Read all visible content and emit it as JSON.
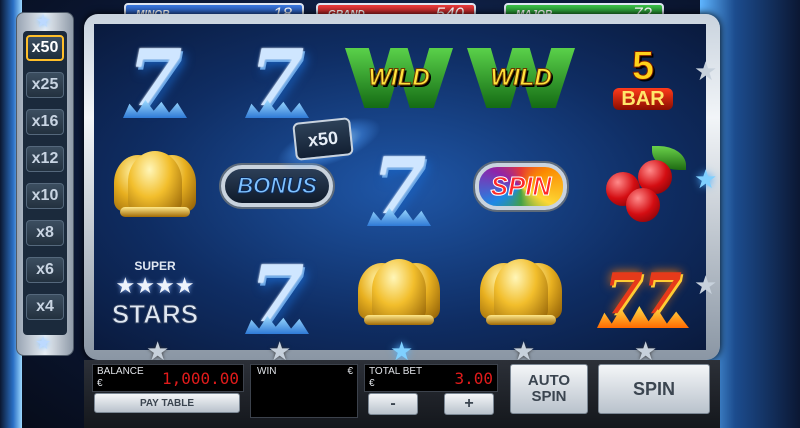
{
  "jackpots": {
    "minor": {
      "label": "MINOR",
      "value": "18"
    },
    "grand": {
      "label": "GRAND",
      "value": "540"
    },
    "major": {
      "label": "MAJOR",
      "value": "72"
    }
  },
  "multipliers": [
    "x50",
    "x25",
    "x16",
    "x12",
    "x10",
    "x8",
    "x6",
    "x4"
  ],
  "active_multiplier": "x50",
  "reels": {
    "symbols": [
      [
        "blue-seven-icon",
        "wild-icon",
        "wild-icon",
        "5-bar-icon",
        "blue-seven-icon"
      ],
      [
        "bell-icon",
        "bonus-icon",
        "blue-seven-icon",
        "spin-icon",
        "cherry-icon"
      ],
      [
        "super-stars-icon",
        "blue-seven-icon",
        "bell-icon",
        "bell-icon",
        "flaming-sevens-icon"
      ]
    ],
    "wild_text": "WILD",
    "bar_number": "5",
    "bar_text": "BAR",
    "bonus_text": "BONUS",
    "spin_text": "SPIN",
    "super_text": "SUPER",
    "stars_text": "STARS",
    "multiplier_badge": "x50"
  },
  "bottom": {
    "balance_label": "BALANCE",
    "balance_currency": "€",
    "balance_value": "1,000.00",
    "win_label": "WIN",
    "win_currency": "€",
    "total_bet_label": "TOTAL BET",
    "total_bet_currency": "€",
    "total_bet_value": "3.00",
    "paytable_label": "PAY TABLE",
    "minus_label": "-",
    "plus_label": "+",
    "auto_spin_label": "AUTO SPIN",
    "spin_label": "SPIN"
  },
  "colors": {
    "minor": "#1f4fb4",
    "grand": "#c41d1d",
    "major": "#22962e",
    "active_multiplier_border": "#ffbf2a",
    "counter_digits": "#e01b1b"
  }
}
